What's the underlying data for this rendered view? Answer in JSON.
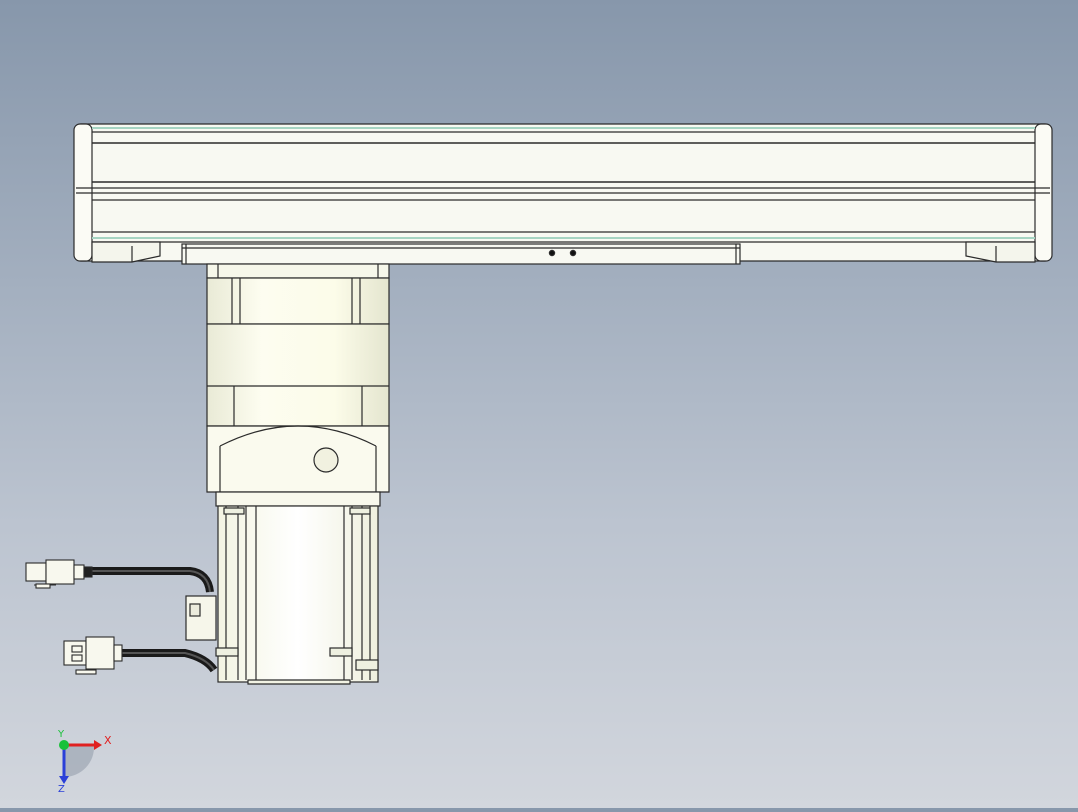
{
  "triad": {
    "x_label": "X",
    "y_label": "Y",
    "z_label": "Z",
    "x_color": "#e02020",
    "y_color": "#19c13a",
    "z_color": "#2a3fd8"
  },
  "palette": {
    "background_top": "#8797ab",
    "background_bottom": "#d2d6dd",
    "body_fill": "#f8f9f2",
    "motor_fill": "#fbfbea",
    "outline": "#2b2b2b",
    "edge_green": "#a6d4c2",
    "cable": "#1a1a1a"
  },
  "icons": [
    "actuator-rail",
    "carriage-plate",
    "gearbox",
    "servo-motor",
    "power-connector",
    "encoder-connector",
    "axis-triad-icon"
  ]
}
